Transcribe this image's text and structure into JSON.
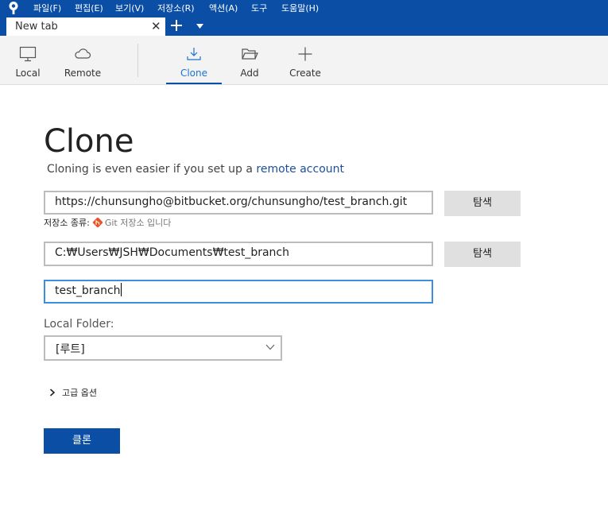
{
  "menubar": {
    "logo_icon": "sourcetree-logo-icon",
    "items": [
      "파일(F)",
      "편집(E)",
      "보기(V)",
      "저장소(R)",
      "액션(A)",
      "도구",
      "도움말(H)"
    ]
  },
  "tabs": {
    "items": [
      {
        "label": "New tab",
        "close_glyph": "✕"
      }
    ],
    "add_icon": "plus-icon",
    "dropdown_icon": "chevron-down-icon"
  },
  "toolbar": {
    "local": {
      "label": "Local",
      "icon": "monitor-icon"
    },
    "remote": {
      "label": "Remote",
      "icon": "cloud-icon"
    },
    "clone": {
      "label": "Clone",
      "icon": "download-icon",
      "active": true
    },
    "add": {
      "label": "Add",
      "icon": "folder-icon"
    },
    "create": {
      "label": "Create",
      "icon": "plus-icon"
    }
  },
  "clone_form": {
    "title": "Clone",
    "subtitle_prefix": "Cloning is even easier if you set up a ",
    "subtitle_link": "remote account",
    "source_url": "https://chunsungho@bitbucket.org/chunsungho/test_branch.git",
    "browse_label": "탐색",
    "repo_type_label": "저장소 종류:",
    "repo_type_value": "Git 저장소 입니다",
    "destination_path": "C:₩Users₩JSH₩Documents₩test_branch",
    "name": "test_branch",
    "local_folder_label": "Local Folder:",
    "local_folder_value": "[루트]",
    "advanced_label": "고급 옵션",
    "clone_button_label": "클론"
  },
  "colors": {
    "accent": "#0a4ea6",
    "link": "#1b4f9c",
    "git": "#e8542b"
  }
}
